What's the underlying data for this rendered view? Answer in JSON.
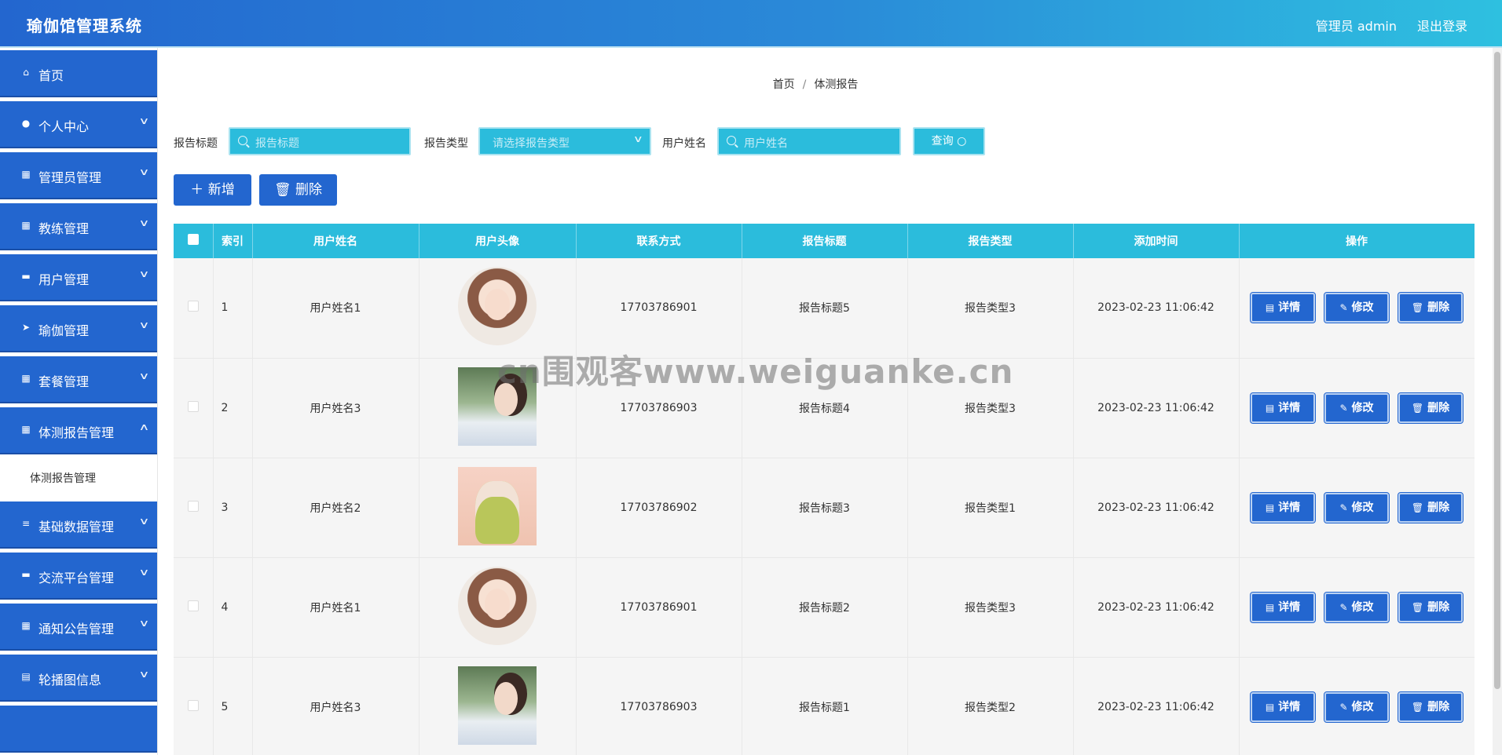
{
  "header": {
    "app_title": "瑜伽馆管理系统",
    "admin_label": "管理员 admin",
    "logout": "退出登录"
  },
  "sidebar": {
    "items": [
      {
        "label": "首页",
        "icon": "home-icon"
      },
      {
        "label": "个人中心",
        "icon": "user-icon"
      },
      {
        "label": "管理员管理",
        "icon": "grid-icon"
      },
      {
        "label": "教练管理",
        "icon": "grid-icon"
      },
      {
        "label": "用户管理",
        "icon": "monitor-icon"
      },
      {
        "label": "瑜伽管理",
        "icon": "send-icon"
      },
      {
        "label": "套餐管理",
        "icon": "grid-icon"
      },
      {
        "label": "体测报告管理",
        "icon": "grid-icon"
      },
      {
        "label": "基础数据管理",
        "icon": "sliders-icon"
      },
      {
        "label": "交流平台管理",
        "icon": "monitor-icon"
      },
      {
        "label": "通知公告管理",
        "icon": "grid-icon"
      },
      {
        "label": "轮播图信息",
        "icon": "clipboard-icon"
      }
    ],
    "sub_item": "体测报告管理"
  },
  "breadcrumb": {
    "home": "首页",
    "sep": "/",
    "current": "体测报告"
  },
  "search": {
    "title_label": "报告标题",
    "title_placeholder": "报告标题",
    "type_label": "报告类型",
    "type_placeholder": "请选择报告类型",
    "user_label": "用户姓名",
    "user_placeholder": "用户姓名",
    "query_button": "查询"
  },
  "actions": {
    "add": "新增",
    "delete": "删除"
  },
  "table": {
    "columns": [
      "索引",
      "用户姓名",
      "用户头像",
      "联系方式",
      "报告标题",
      "报告类型",
      "添加时间",
      "操作"
    ],
    "rows": [
      {
        "index": "1",
        "name": "用户姓名1",
        "avatar": "a",
        "phone": "17703786901",
        "title": "报告标题5",
        "type": "报告类型3",
        "time": "2023-02-23 11:06:42"
      },
      {
        "index": "2",
        "name": "用户姓名3",
        "avatar": "b",
        "phone": "17703786903",
        "title": "报告标题4",
        "type": "报告类型3",
        "time": "2023-02-23 11:06:42"
      },
      {
        "index": "3",
        "name": "用户姓名2",
        "avatar": "c",
        "phone": "17703786902",
        "title": "报告标题3",
        "type": "报告类型1",
        "time": "2023-02-23 11:06:42"
      },
      {
        "index": "4",
        "name": "用户姓名1",
        "avatar": "a",
        "phone": "17703786901",
        "title": "报告标题2",
        "type": "报告类型3",
        "time": "2023-02-23 11:06:42"
      },
      {
        "index": "5",
        "name": "用户姓名3",
        "avatar": "b",
        "phone": "17703786903",
        "title": "报告标题1",
        "type": "报告类型2",
        "time": "2023-02-23 11:06:42"
      }
    ],
    "row_actions": {
      "detail": "详情",
      "edit": "修改",
      "delete": "删除"
    }
  },
  "watermark": "cn围观客www.weiguanke.cn",
  "colors": {
    "primary": "#2366cf",
    "accent": "#2bbcdc"
  }
}
